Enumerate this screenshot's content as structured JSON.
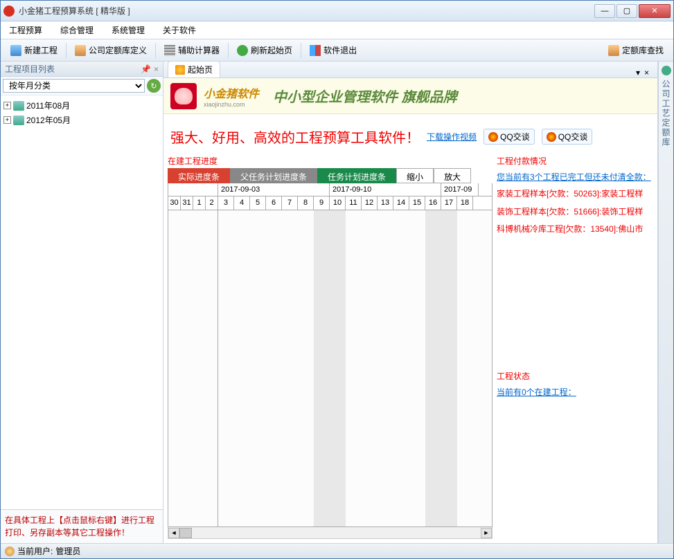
{
  "window": {
    "title": "小金猪工程预算系统 [ 精华版 ]"
  },
  "menu": {
    "budget": "工程预算",
    "manage": "综合管理",
    "system": "系统管理",
    "about": "关于软件"
  },
  "toolbar": {
    "new_project": "新建工程",
    "quota_def": "公司定额库定义",
    "calc": "辅助计算器",
    "refresh_home": "刷新起始页",
    "exit": "软件退出",
    "quota_search": "定额库查找"
  },
  "left": {
    "title": "工程项目列表",
    "filter": "按年月分类",
    "items": [
      {
        "label": "2011年08月"
      },
      {
        "label": "2012年05月"
      }
    ],
    "hint": "在具体工程上【点击鼠标右键】进行工程打印、另存副本等其它工程操作！"
  },
  "tabs": {
    "home": "起始页"
  },
  "banner": {
    "brand": "小金猪软件",
    "sub": "xiaojinzhu.com",
    "slogan": "中小型企业管理软件 旗舰品牌"
  },
  "headline": {
    "text": "强大、好用、高效的工程预算工具软件！",
    "video_link": "下载操作视频",
    "qq": "QQ交谈"
  },
  "gantt": {
    "section": "在建工程进度",
    "tabs": {
      "actual": "实际进度条",
      "parent": "父任务计划进度条",
      "task": "任务计划进度条",
      "shrink": "缩小",
      "enlarge": "放大"
    },
    "weeks": [
      "2017-09-03",
      "2017-09-10",
      "2017-09"
    ],
    "left_days": [
      "30",
      "31",
      "1",
      "2"
    ],
    "days": [
      "3",
      "4",
      "5",
      "6",
      "7",
      "8",
      "9",
      "10",
      "11",
      "12",
      "13",
      "14",
      "15",
      "16",
      "17",
      "18"
    ]
  },
  "payment": {
    "title": "工程付款情况",
    "link": "您当前有3个工程已完工但还未付清全款：",
    "lines": [
      "家装工程样本[欠款：50263]:家装工程样",
      "装饰工程样本[欠款：51666]:装饰工程样",
      "科博机械冷库工程[欠款：13540]:佛山市"
    ]
  },
  "status_block": {
    "title": "工程状态",
    "link": "当前有0个在建工程："
  },
  "right_sidebar": "公司工艺定额库",
  "status": {
    "user_label": "当前用户:",
    "user": "管理员"
  }
}
